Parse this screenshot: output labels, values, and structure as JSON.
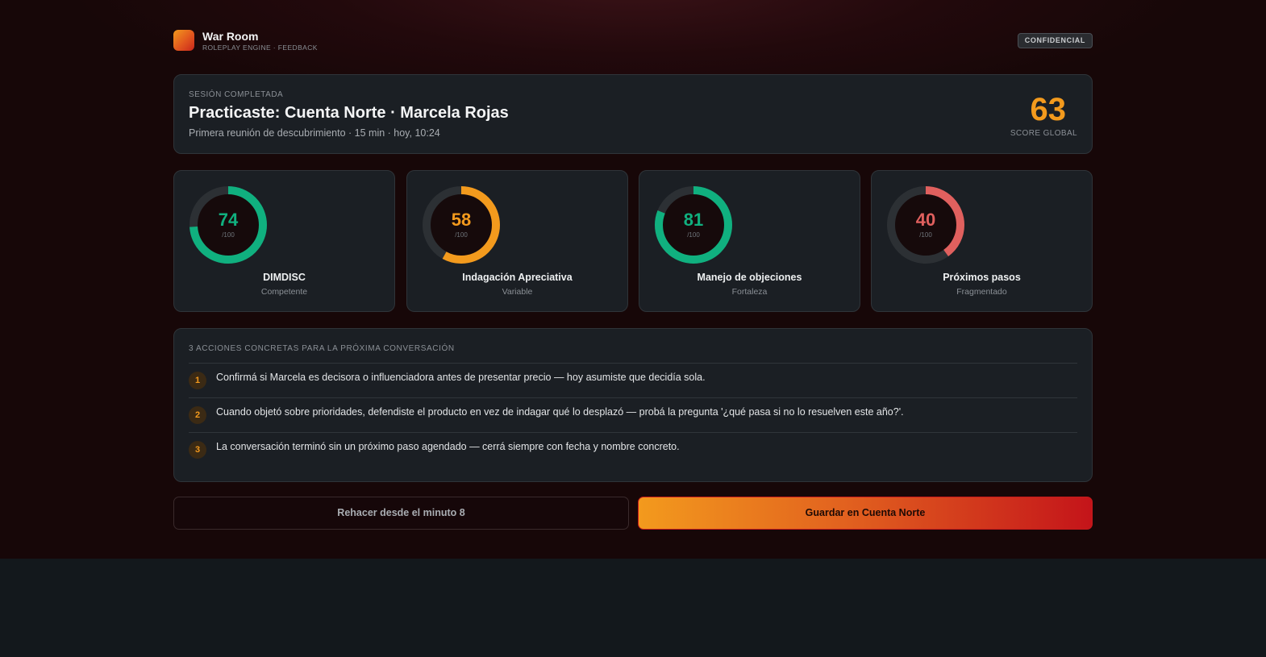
{
  "header": {
    "app_name": "War Room",
    "app_subtitle": "ROLEPLAY ENGINE · FEEDBACK",
    "badge": "CONFIDENCIAL"
  },
  "session": {
    "eyebrow": "SESIÓN COMPLETADA",
    "title": "Practicaste: Cuenta Norte · Marcela Rojas",
    "meta": "Primera reunión de descubrimiento · 15 min · hoy, 10:24",
    "score": "63",
    "score_label": "SCORE GLOBAL",
    "score_color": "#f39a1d"
  },
  "metrics": [
    {
      "value": "74",
      "unit": "/100",
      "name": "DIMDISC",
      "level": "Competente",
      "color": "#10b07f"
    },
    {
      "value": "58",
      "unit": "/100",
      "name": "Indagación Apreciativa",
      "level": "Variable",
      "color": "#f39a1d"
    },
    {
      "value": "81",
      "unit": "/100",
      "name": "Manejo de objeciones",
      "level": "Fortaleza",
      "color": "#10b07f"
    },
    {
      "value": "40",
      "unit": "/100",
      "name": "Próximos pasos",
      "level": "Fragmentado",
      "color": "#e0605e"
    }
  ],
  "actions": {
    "title": "3 ACCIONES CONCRETAS PARA LA PRÓXIMA CONVERSACIÓN",
    "items": [
      {
        "num": "1",
        "text": "Confirmá si Marcela es decisora o influenciadora antes de presentar precio — hoy asumiste que decidía sola."
      },
      {
        "num": "2",
        "text": "Cuando objetó sobre prioridades, defendiste el producto en vez de indagar qué lo desplazó — probá la pregunta '¿qué pasa si no lo resuelven este año?'."
      },
      {
        "num": "3",
        "text": "La conversación terminó sin un próximo paso agendado — cerrá siempre con fecha y nombre concreto."
      }
    ]
  },
  "buttons": {
    "redo": "Rehacer desde el minuto 8",
    "save": "Guardar en Cuenta Norte"
  }
}
